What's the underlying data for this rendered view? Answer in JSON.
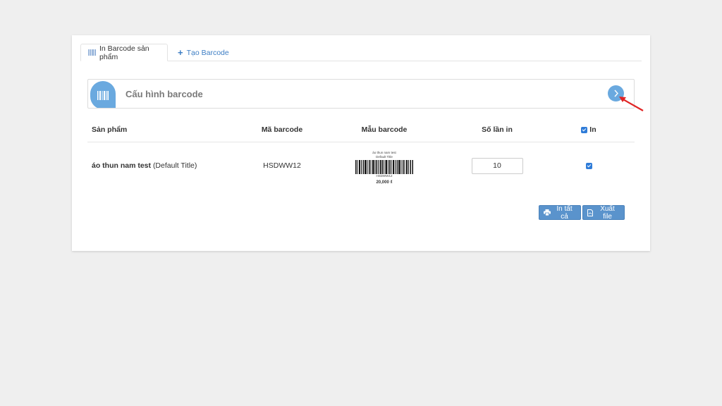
{
  "tabs": [
    {
      "label": "In Barcode sản phẩm",
      "icon": "barcode-icon",
      "active": true
    },
    {
      "label": "Tạo Barcode",
      "icon": "plus-icon",
      "active": false
    }
  ],
  "config": {
    "title": "Cấu hình barcode",
    "icon": "barcode-icon",
    "action_icon": "chevron-right-icon"
  },
  "table": {
    "headers": {
      "product": "Sản phẩm",
      "barcode": "Mã barcode",
      "template": "Mẫu barcode",
      "count": "Số lần in",
      "print": "In"
    },
    "rows": [
      {
        "product_name": "áo thun nam test",
        "variant": "(Default Title)",
        "barcode": "HSDWW12",
        "label_name": "áo thun nam test",
        "label_variant": "Default Title",
        "label_code": "HSDWW12",
        "label_price": "20,000 ₫",
        "count": "10",
        "checked": true
      }
    ]
  },
  "buttons": {
    "print_all": "In tất cả",
    "export": "Xuất file"
  },
  "colors": {
    "accent": "#6aa9df",
    "button": "#5a93cc",
    "link": "#3d7ec4",
    "arrow": "#e02424"
  }
}
